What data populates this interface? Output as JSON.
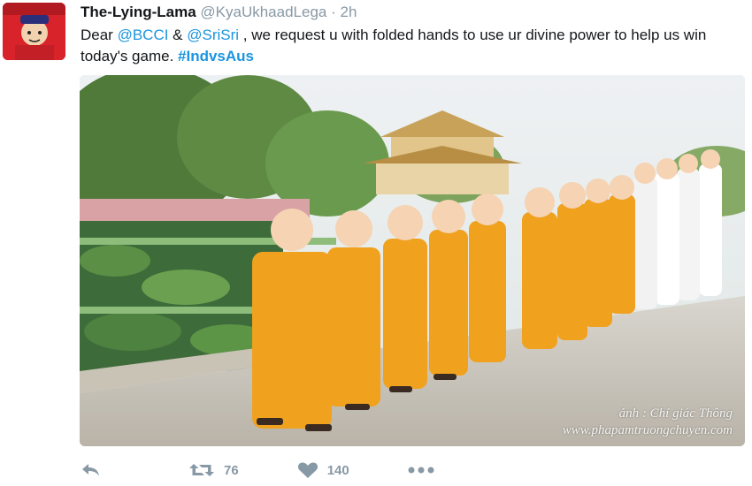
{
  "tweet": {
    "display_name": "The-Lying-Lama",
    "handle": "@KyaUkhaadLega",
    "separator": "·",
    "time": "2h",
    "text": {
      "part1": "Dear ",
      "mention1": "@BCCI",
      "part2": " & ",
      "mention2": "@SriSri",
      "part3": " , we request u with folded hands to use ur divine power to help us win today's game. ",
      "hashtag": "#IndvsAus"
    },
    "photo": {
      "watermark_line1": "ảnh : Chí giác Thông",
      "watermark_line2": "www.phapamtruongchuyen.com"
    }
  },
  "actions": {
    "reply_icon": "reply-arrow-icon",
    "retweet_icon": "retweet-icon",
    "retweet_count": "76",
    "like_icon": "heart-icon",
    "like_count": "140",
    "more_icon": "ellipsis-icon"
  },
  "colors": {
    "link": "#1b95e0",
    "muted": "#8899a6",
    "robe": "#f0a11e"
  }
}
